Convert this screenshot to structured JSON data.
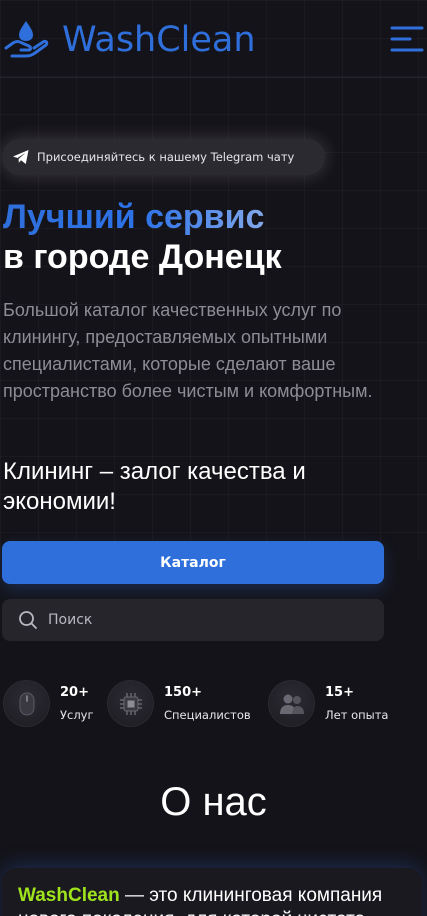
{
  "header": {
    "brand": "WashClean",
    "menu_icon": "hamburger-menu-icon",
    "logo_icon": "droplet-hand-icon",
    "brand_color": "#2f6fdb"
  },
  "telegram": {
    "icon": "telegram-plane-icon",
    "label": "Присоединяйтесь к нашему Telegram чату"
  },
  "hero": {
    "title_accent": "Лучший сервис",
    "title_rest": "в городе Донецк",
    "description": "Большой каталог качественных услуг по клинингу, предоставляемых опытными специалистами, которые сделают ваше пространство более чистым и комфортным.",
    "slogan": "Клининг – залог качества и экономии!"
  },
  "catalog_button": "Каталог",
  "search": {
    "placeholder": "Поиск",
    "icon": "search-icon"
  },
  "stats": [
    {
      "icon": "mouse-icon",
      "number": "20+",
      "label": "Услуг"
    },
    {
      "icon": "chip-icon",
      "number": "150+",
      "label": "Специалистов"
    },
    {
      "icon": "users-icon",
      "number": "15+",
      "label": "Лет опыта"
    }
  ],
  "about": {
    "title": "О нас",
    "brand": "WashClean",
    "text": " — это клининговая компания нового поколения, для которой чистота",
    "brand_color": "#9fe31c"
  }
}
